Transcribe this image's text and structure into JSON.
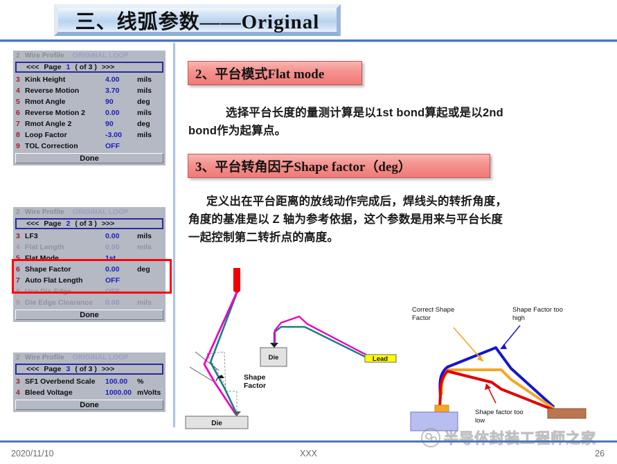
{
  "slide": {
    "title": "三、线弧参数——Original"
  },
  "panels": [
    {
      "name": "page1",
      "head": {
        "num": "2",
        "label": "Wire Profile",
        "value": "ORIGINAL LOOP"
      },
      "page": {
        "prev": "<<<",
        "label": "Page",
        "number": "1",
        "of": "( of 3 )",
        "next": ">>>"
      },
      "rows": [
        {
          "num": "3",
          "label": "Kink Height",
          "value": "4.00",
          "unit": "mils",
          "dim": false
        },
        {
          "num": "4",
          "label": "Reverse Motion",
          "value": "3.70",
          "unit": "mils",
          "dim": false
        },
        {
          "num": "5",
          "label": "Rmot Angle",
          "value": "90",
          "unit": "deg",
          "dim": false
        },
        {
          "num": "6",
          "label": "Reverse Motion 2",
          "value": "0.00",
          "unit": "mils",
          "dim": false
        },
        {
          "num": "7",
          "label": "Rmot Angle 2",
          "value": "90",
          "unit": "deg",
          "dim": false
        },
        {
          "num": "8",
          "label": "Loop Factor",
          "value": "-3.00",
          "unit": "mils",
          "dim": false
        },
        {
          "num": "9",
          "label": "TOL Correction",
          "value": "OFF",
          "unit": "",
          "dim": false
        }
      ],
      "done": "Done"
    },
    {
      "name": "page2",
      "head": {
        "num": "2",
        "label": "Wire Profile",
        "value": "ORIGINAL LOOP"
      },
      "page": {
        "prev": "<<<",
        "label": "Page",
        "number": "2",
        "of": "( of 3 )",
        "next": ">>>"
      },
      "rows": [
        {
          "num": "3",
          "label": "LF3",
          "value": "0.00",
          "unit": "mils",
          "dim": false
        },
        {
          "num": "4",
          "label": "Flat Length",
          "value": "0.00",
          "unit": "mils",
          "dim": true
        },
        {
          "num": "5",
          "label": "Flat Mode",
          "value": "1st",
          "unit": "",
          "dim": false
        },
        {
          "num": "6",
          "label": "Shape Factor",
          "value": "0.00",
          "unit": "deg",
          "dim": false
        },
        {
          "num": "7",
          "label": "Auto Flat Length",
          "value": "OFF",
          "unit": "",
          "dim": false
        },
        {
          "num": "8",
          "label": "Use Die Edge",
          "value": "OFF",
          "unit": "",
          "dim": true
        },
        {
          "num": "9",
          "label": "Die Edge Clearance",
          "value": "0.00",
          "unit": "mils",
          "dim": true
        }
      ],
      "done": "Done"
    },
    {
      "name": "page3",
      "head": {
        "num": "2",
        "label": "Wire Profile",
        "value": "ORIGINAL LOOP"
      },
      "page": {
        "prev": "<<<",
        "label": "Page",
        "number": "3",
        "of": "( of 3 )",
        "next": ">>>"
      },
      "rows": [
        {
          "num": "3",
          "label": "SF1 Overbend Scale",
          "value": "100.00",
          "unit": "%",
          "dim": false
        },
        {
          "num": "4",
          "label": "Bleed Voltage",
          "value": "1000.00",
          "unit": "mVolts",
          "dim": false
        }
      ],
      "done": "Done"
    }
  ],
  "highlight": {
    "color": "#fd0005",
    "targets": [
      "Flat Length",
      "Flat Mode",
      "Shape Factor"
    ]
  },
  "content": {
    "section2": {
      "heading": "2、平台模式Flat mode",
      "para_line1": "选择平台长度的量测计算是以1st bond算起或是以2nd",
      "para_line2": "bond作为起算点。"
    },
    "section3": {
      "heading": "3、平台转角因子Shape factor（deg）",
      "para_line1": "定义出在平台距离的放线动作完成后，焊线头的转折角度，",
      "para_line2": "角度的基准是以 Z 轴为参考依据，这个参数是用来与平台长度",
      "para_line3": "一起控制第二转折点的高度。"
    }
  },
  "figure_left": {
    "labels": {
      "shape_factor_line1": "Shape",
      "shape_factor_line2": "Factor",
      "die_bottom": "Die",
      "die_mid": "Die",
      "lead": "Lead"
    },
    "colors": {
      "wire_magenta": "#ec00c8",
      "wire_teal": "#128080",
      "capillary": "#ee0000",
      "lead_pad": "#ffff00"
    }
  },
  "figure_right": {
    "labels": {
      "correct_line1": "Correct Shape",
      "correct_line2": "Factor",
      "too_high_line1": "Shape Factor too",
      "too_high_line2": "high",
      "too_low_line1": "Shape factor too",
      "too_low_line2": "low"
    },
    "colors": {
      "blue_loop": "#1515cc",
      "orange_loop": "#f5a623",
      "red_loop": "#e00000",
      "die_block": "#b9bef0",
      "lead_block": "#b9764f"
    }
  },
  "footer": {
    "date": "2020/11/10",
    "center": "XXX",
    "page": "26"
  },
  "watermark": {
    "text": "半导体封装工程师之家",
    "logo_icon": "speech-bubbles-icon"
  }
}
